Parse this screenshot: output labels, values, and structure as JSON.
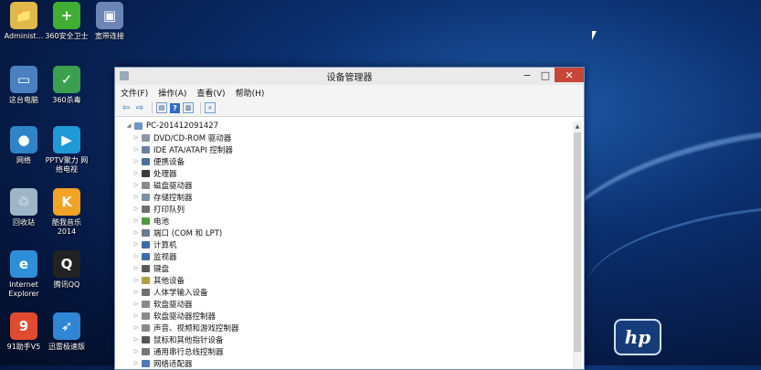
{
  "desktop": {
    "icons": [
      {
        "label": "Administ...",
        "glyph": "📁",
        "color": "#e1b84a"
      },
      {
        "label": "360安全卫士",
        "glyph": "+",
        "color": "#3fae33"
      },
      {
        "label": "宽带连接",
        "glyph": "▣",
        "color": "#6b86b5"
      },
      {
        "label": "这台电脑",
        "glyph": "▭",
        "color": "#4a7fc1"
      },
      {
        "label": "360杀毒",
        "glyph": "✓",
        "color": "#3aa04f"
      },
      {
        "label": "网络",
        "glyph": "●",
        "color": "#2f84c8"
      },
      {
        "label": "PPTV聚力 网络电视",
        "glyph": "▶",
        "color": "#1e9ad6"
      },
      {
        "label": "回收站",
        "glyph": "♲",
        "color": "#9fb6c8"
      },
      {
        "label": "酷我音乐 2014",
        "glyph": "K",
        "color": "#f2a324"
      },
      {
        "label": "Internet Explorer",
        "glyph": "e",
        "color": "#2e8fd8"
      },
      {
        "label": "腾讯QQ",
        "glyph": "Q",
        "color": "#222222"
      },
      {
        "label": "91助手V5",
        "glyph": "9",
        "color": "#e04b2f"
      },
      {
        "label": "迅雷极速版",
        "glyph": "➶",
        "color": "#2f86d4"
      }
    ],
    "hp_logo": "hp"
  },
  "window": {
    "title": "设备管理器",
    "controls": {
      "minimize": "−",
      "maximize": "□",
      "close": "✕"
    },
    "menu": [
      "文件(F)",
      "操作(A)",
      "查看(V)",
      "帮助(H)"
    ],
    "toolbar_icons": [
      "back-arrow-icon",
      "forward-arrow-icon",
      "properties-icon",
      "help-icon",
      "view-icon",
      "scan-hardware-icon"
    ],
    "tree": {
      "root": "PC-201412091427",
      "items": [
        "DVD/CD-ROM 驱动器",
        "IDE ATA/ATAPI 控制器",
        "便携设备",
        "处理器",
        "磁盘驱动器",
        "存储控制器",
        "打印队列",
        "电池",
        "端口 (COM 和 LPT)",
        "计算机",
        "监视器",
        "键盘",
        "其他设备",
        "人体学输入设备",
        "软盘驱动器",
        "软盘驱动器控制器",
        "声音、视频和游戏控制器",
        "鼠标和其他指针设备",
        "通用串行总线控制器",
        "网络适配器"
      ]
    }
  }
}
